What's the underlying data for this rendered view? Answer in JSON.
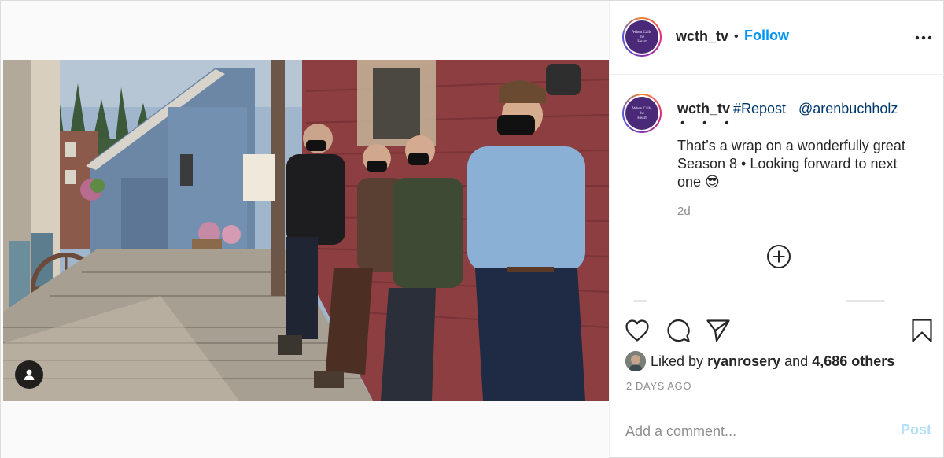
{
  "post": {
    "username": "wcth_tv",
    "follow_label": "Follow",
    "separator": "•",
    "avatar_logo_lines": [
      "When Calls",
      "the",
      "Heart"
    ]
  },
  "caption": {
    "username": "wcth_tv",
    "hashtag": "#Repost",
    "mention": "@arenbuchholz",
    "dots": "• • •",
    "text": "That’s a wrap on a wonderfully great Season 8 • Looking forward to next one 😎",
    "time": "2d"
  },
  "likes": {
    "prefix": "Liked by",
    "user": "ryanrosery",
    "and": "and",
    "others": "4,686 others"
  },
  "date_label": "2 DAYS AGO",
  "comment": {
    "placeholder": "Add a comment...",
    "post_label": "Post"
  },
  "icons": {
    "more": "more-horizontal-icon",
    "tagged_users": "user-silhouette-icon",
    "load_more": "plus-circle-icon",
    "like": "heart-icon",
    "comment": "speech-bubble-icon",
    "share": "paper-plane-icon",
    "save": "bookmark-icon"
  },
  "colors": {
    "accent": "#0095f6",
    "link": "#00376b",
    "muted": "#8e8e8e",
    "post_disabled": "#b2dffc"
  }
}
